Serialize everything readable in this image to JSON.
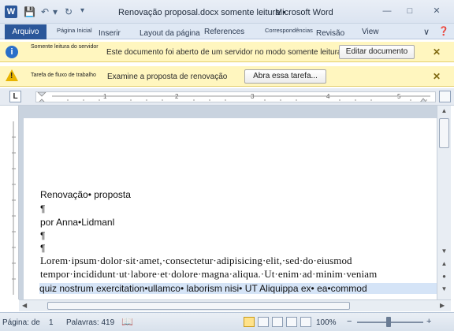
{
  "window": {
    "title": "Renovação proposal.docx somente leitura •",
    "app_name": "Microsoft Word",
    "app_icon_letter": "W"
  },
  "quick_access": {
    "save_icon": "save-icon",
    "undo_icon": "undo-icon",
    "redo_icon": "redo-icon",
    "customize_icon": "chevron-down-icon"
  },
  "ribbon": {
    "file_tab": "Arquivo",
    "tabs": [
      "Página Inicial",
      "Inserir",
      "Layout da página",
      "References",
      "Correspondências",
      "Revisão",
      "View"
    ]
  },
  "messages": [
    {
      "label": "Somente leitura do servidor",
      "text": "Este documento foi aberto de um servidor no modo somente leitura.",
      "button": "Editar documento",
      "icon": "info-icon"
    },
    {
      "label": "Tarefa de fluxo de trabalho",
      "text": "Examine a proposta de renovação",
      "button": "Abra essa tarefa...",
      "icon": "warning-icon"
    }
  ],
  "ruler": {
    "tab_selector": "L",
    "numbers": [
      "1",
      "2",
      "3",
      "4",
      "5"
    ]
  },
  "document": {
    "lines": [
      "Renovação• proposta",
      "¶",
      "por Anna•Lidmanl",
      "¶",
      "¶",
      "Lorem·ipsum·dolor·sit·amet,·consectetur·adipisicing·elit,·sed·do·eiusmod",
      "tempor·incididunt·ut·labore·et·dolore·magna·aliqua.·Ut·enim·ad·minim·veniam",
      "quiz nostrum exercitation•ullamco• laborism nisi• UT Aliquippa ex• ea•commod"
    ]
  },
  "status": {
    "page_label": "Página: de",
    "page_value": "1",
    "words_label": "Palavras: 419",
    "zoom": "100%",
    "zoom_minus": "−",
    "zoom_plus": "+"
  },
  "colors": {
    "accent": "#2b579a",
    "message_bar": "#fff6bf",
    "selection": "#d5e4f7"
  }
}
